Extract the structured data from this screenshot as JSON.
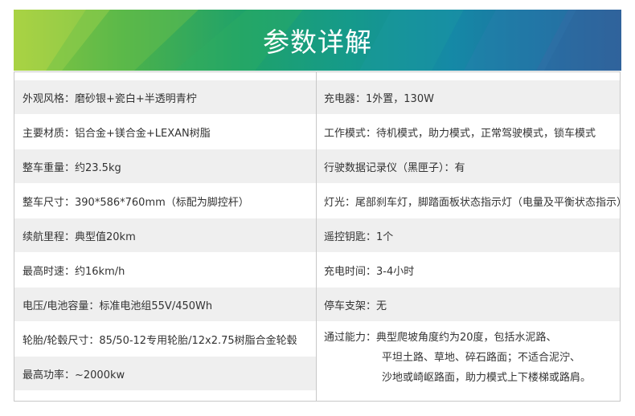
{
  "header": {
    "title": "参数详解"
  },
  "left_rows": [
    "外观风格：磨砂银+瓷白+半透明青柠",
    "主要材质：铝合金+镁合金+LEXAN树脂",
    "整车重量：约23.5kg",
    "整车尺寸：390*586*760mm（标配为脚控杆）",
    "续航里程：典型值20km",
    "最高时速：约16km/h",
    "电压/电池容量：标准电池组55V/450Wh",
    "轮胎/轮毂尺寸：85/50-12专用轮胎/12x2.75树脂合金轮毂",
    "最高功率：~2000kw"
  ],
  "right_rows": [
    "充电器：1外置，130W",
    "工作模式：待机模式，助力模式，正常驾驶模式，锁车模式",
    "行驶数据记录仪（黑匣子）：有",
    "灯光：尾部刹车灯，脚踏面板状态指示灯（电量及平衡状态指示）",
    "遥控钥匙：1个",
    "充电时间：3-4小时",
    "停车支架：无"
  ],
  "passability": {
    "line1": "通过能力：典型爬坡角度约为20度，包括水泥路、",
    "line2": "平坦土路、草地、碎石路面；不适合泥泞、",
    "line3": "沙地或崎岖路面，助力模式上下楼梯或路肩。"
  },
  "colors": {
    "banner_start": "#9ccb3b",
    "banner_end": "#2a5f95",
    "row_shade": "#efefef",
    "border": "#c8c8c8"
  }
}
